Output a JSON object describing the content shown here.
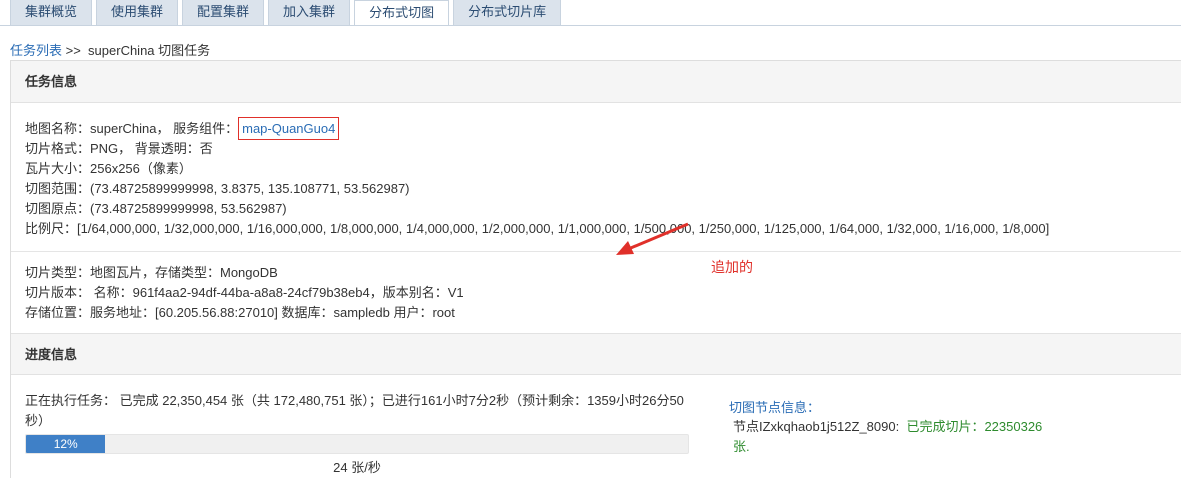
{
  "tabs": [
    {
      "label": "集群概览"
    },
    {
      "label": "使用集群"
    },
    {
      "label": "配置集群"
    },
    {
      "label": "加入集群"
    },
    {
      "label": "分布式切图"
    },
    {
      "label": "分布式切片库"
    }
  ],
  "breadcrumb": {
    "link": "任务列表",
    "sep": " >>  ",
    "current": "superChina 切图任务"
  },
  "task_info": {
    "heading": "任务信息",
    "map_name_prefix": "地图名称：superChina， 服务组件：",
    "service_component": "map-QuanGuo4",
    "format": "切片格式：PNG， 背景透明：否",
    "tile_size": "瓦片大小：256x256（像素）",
    "extent": "切图范围：(73.48725899999998, 3.8375, 135.108771, 53.562987)",
    "origin": "切图原点：(73.48725899999998, 53.562987)",
    "scales": "比例尺：[1/64,000,000, 1/32,000,000, 1/16,000,000, 1/8,000,000, 1/4,000,000, 1/2,000,000, 1/1,000,000, 1/500,000, 1/250,000, 1/125,000, 1/64,000, 1/32,000, 1/16,000, 1/8,000]",
    "tile_type": "切片类型：地图瓦片，存储类型：MongoDB",
    "tile_version": "切片版本： 名称：961f4aa2-94df-44ba-a8a8-24cf79b38eb4，版本别名：V1",
    "storage": "存储位置：服务地址：[60.205.56.88:27010]  数据库：sampledb  用户：root"
  },
  "annotation": {
    "text": "追加的",
    "color": "#e0302a"
  },
  "progress_info": {
    "heading": "进度信息",
    "status_text": "正在执行任务： 已完成 22,350,454 张（共 172,480,751 张）；已进行161小时7分2秒（预计剩余：1359小时26分50秒）",
    "percent_label": "12%",
    "percent_value": 0.12,
    "speed": "24 张/秒"
  },
  "node_info": {
    "title": "切图节点信息：",
    "node_prefix": "节点IZxkqhaob1j512Z_8090:  ",
    "done_text": "已完成切片：22350326",
    "tail": "张."
  },
  "colors": {
    "accent": "#2a6cb5",
    "progress": "#3f80c7",
    "success": "#2e8b2e"
  }
}
